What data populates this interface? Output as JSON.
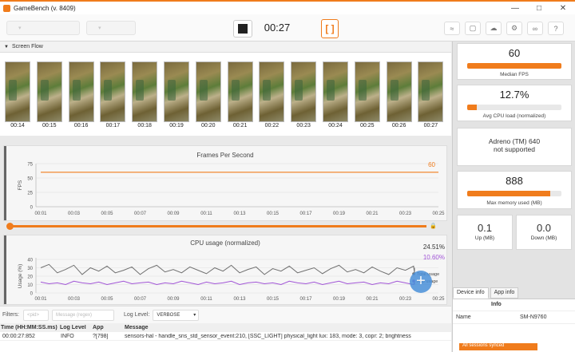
{
  "app": {
    "title": "GameBench (v. 8409)"
  },
  "toolbar": {
    "timer": "00:27",
    "mark_label": "[ ]"
  },
  "screen_flow": {
    "label": "Screen Flow",
    "timestamps": [
      "00:14",
      "00:15",
      "00:16",
      "00:17",
      "00:18",
      "00:19",
      "00:20",
      "00:21",
      "00:22",
      "00:23",
      "00:24",
      "00:25",
      "00:26",
      "00:27"
    ]
  },
  "fps_chart": {
    "title": "Frames Per Second",
    "ylabel": "FPS",
    "current_value": "60",
    "yticks": [
      "75",
      "50",
      "25",
      "0"
    ],
    "xticks": [
      "00:01",
      "00:03",
      "00:05",
      "00:07",
      "00:09",
      "00:11",
      "00:13",
      "00:15",
      "00:17",
      "00:19",
      "00:21",
      "00:23",
      "00:25"
    ],
    "color": "#f07c1c"
  },
  "cpu_chart": {
    "title": "CPU usage (normalized)",
    "ylabel": "Usage (%)",
    "value_total": "24.51%",
    "value_app": "10.60%",
    "yticks": [
      "40",
      "30",
      "20",
      "10",
      "0"
    ],
    "xticks": [
      "00:01",
      "00:03",
      "00:05",
      "00:07",
      "00:09",
      "00:11",
      "00:13",
      "00:15",
      "00:17",
      "00:19",
      "00:21",
      "00:23",
      "00:25"
    ],
    "legend": [
      "Total usage",
      "App usage"
    ],
    "total_color": "#707070",
    "app_color": "#a155d6"
  },
  "chart_data": [
    {
      "type": "line",
      "title": "Frames Per Second",
      "ylabel": "FPS",
      "ylim": [
        0,
        75
      ],
      "x": [
        "00:01",
        "00:03",
        "00:05",
        "00:07",
        "00:09",
        "00:11",
        "00:13",
        "00:15",
        "00:17",
        "00:19",
        "00:21",
        "00:23",
        "00:25"
      ],
      "series": [
        {
          "values": [
            60,
            60,
            60,
            60,
            60,
            60,
            60,
            60,
            60,
            60,
            60,
            60,
            60
          ]
        }
      ]
    },
    {
      "type": "line",
      "title": "CPU usage (normalized)",
      "ylabel": "Usage (%)",
      "ylim": [
        0,
        40
      ],
      "x": [
        1,
        1.5,
        2,
        2.5,
        3,
        3.5,
        4,
        4.5,
        5,
        5.5,
        6,
        6.5,
        7,
        7.5,
        8,
        8.5,
        9,
        9.5,
        10,
        10.5,
        11,
        11.5,
        12,
        12.5,
        13,
        13.5,
        14,
        14.5,
        15,
        15.5,
        16,
        16.5,
        17,
        17.5,
        18,
        18.5,
        19,
        19.5,
        20,
        20.5,
        21,
        21.5,
        22,
        22.5,
        23,
        23.5,
        24,
        24.5,
        25,
        25.5,
        26
      ],
      "series": [
        {
          "name": "Total usage",
          "values": [
            30,
            34,
            24,
            28,
            33,
            22,
            30,
            26,
            32,
            24,
            27,
            31,
            22,
            29,
            33,
            25,
            28,
            24,
            31,
            27,
            23,
            30,
            26,
            33,
            24,
            28,
            31,
            22,
            29,
            26,
            32,
            24,
            27,
            30,
            23,
            29,
            33,
            25,
            28,
            24,
            31,
            26,
            22,
            30,
            27,
            32,
            24,
            28,
            25,
            30,
            24
          ]
        },
        {
          "name": "App usage",
          "values": [
            13,
            11,
            12,
            10,
            14,
            12,
            11,
            13,
            10,
            12,
            14,
            11,
            12,
            13,
            10,
            12,
            11,
            14,
            12,
            10,
            13,
            11,
            12,
            14,
            10,
            12,
            13,
            11,
            12,
            10,
            14,
            12,
            11,
            13,
            10,
            12,
            14,
            11,
            12,
            13,
            10,
            12,
            11,
            14,
            12,
            10,
            13,
            11,
            12,
            11,
            10
          ]
        }
      ]
    }
  ],
  "filters": {
    "label": "Filters:",
    "pid_placeholder": "<pid>",
    "message_placeholder": "Message (regex)",
    "log_level_label": "Log Level:",
    "log_level_value": "VERBOSE"
  },
  "log": {
    "headers": [
      "Time (HH:MM:SS.ms)",
      "Log Level",
      "App",
      "Message"
    ],
    "rows": [
      [
        "00:00:27:852",
        "INFO",
        "?[798]",
        "sensors-hal - handle_sns_std_sensor_event:210, [SSC_LIGHT] physical_light lux: 183, mode: 3, copr: 2; brightness"
      ]
    ]
  },
  "metrics": {
    "median_fps": {
      "value": "60",
      "label": "Median FPS",
      "fraction": 1.0
    },
    "avg_cpu": {
      "value": "12.7%",
      "label": "Avg CPU load (normalized)",
      "fraction": 0.1
    },
    "gpu": {
      "line1": "Adreno (TM) 640",
      "line2": "not supported"
    },
    "max_memory": {
      "value": "888",
      "label": "Max memory used (MB)",
      "fraction": 0.88
    },
    "up": {
      "value": "0.1",
      "label": "Up (MB)"
    },
    "down": {
      "value": "0.0",
      "label": "Down (MB)"
    }
  },
  "device_tabs": [
    "Device info",
    "App info"
  ],
  "device_info": {
    "header": "Info",
    "name_label": "Name",
    "name_value": "SM-N9760",
    "status": "All sessions synced"
  }
}
